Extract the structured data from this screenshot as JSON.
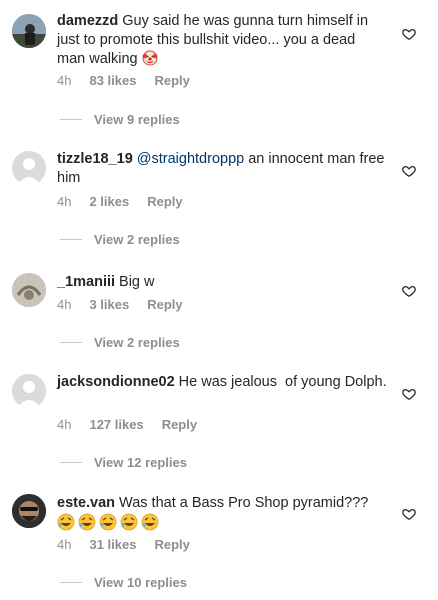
{
  "comments": [
    {
      "username": "damezzd",
      "text": "Guy said he was gunna turn himself in just to promote this bullshit video... you a dead man walking",
      "emoji_icon": "clown-face-icon",
      "time": "4h",
      "likes": "83 likes",
      "reply_label": "Reply",
      "view_replies": "View 9 replies"
    },
    {
      "username": "tizzle18_19",
      "mention": "@straightdroppp",
      "text": "an innocent man free him",
      "time": "4h",
      "likes": "2 likes",
      "reply_label": "Reply",
      "view_replies": "View 2 replies"
    },
    {
      "username": "_1maniii",
      "text": "Big w",
      "time": "4h",
      "likes": "3 likes",
      "reply_label": "Reply",
      "view_replies": "View 2 replies"
    },
    {
      "username": "jacksondionne02",
      "text": "He was jealous  of young Dolph.",
      "time": "4h",
      "likes": "127 likes",
      "reply_label": "Reply",
      "view_replies": "View 12 replies"
    },
    {
      "username": "este.van",
      "text": "Was that a Bass Pro Shop pyramid???",
      "emoji_icon": "rolling-on-floor-laughing-icon",
      "emoji_count": 5,
      "time": "4h",
      "likes": "31 likes",
      "reply_label": "Reply",
      "view_replies": "View 10 replies"
    }
  ],
  "colors": {
    "text": "#262626",
    "meta": "#8e8e8e",
    "mention": "#00376b"
  }
}
